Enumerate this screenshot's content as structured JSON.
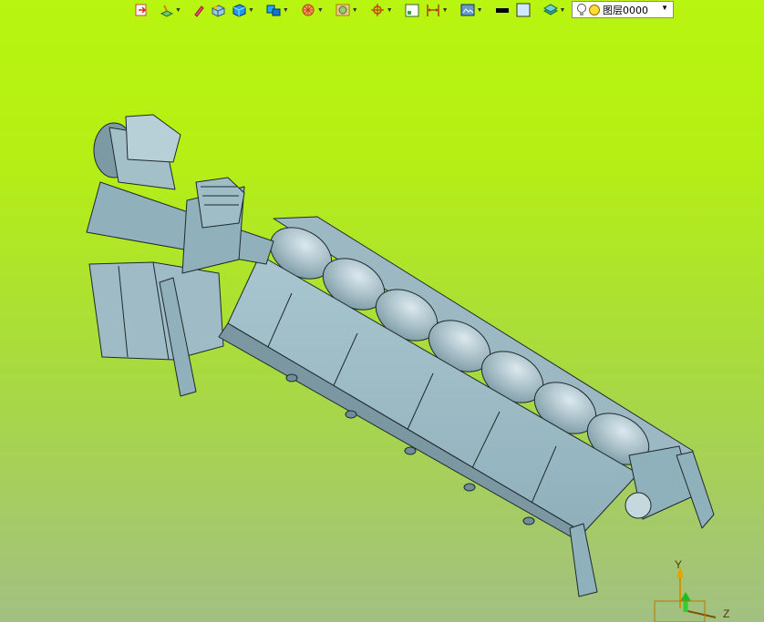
{
  "toolbar": {
    "buttons": [
      {
        "name": "exit-sketch-icon",
        "has_menu": false
      },
      {
        "name": "sketch-plane-icon",
        "has_menu": true
      },
      {
        "name": "pencil-edit-icon",
        "has_menu": false
      },
      {
        "name": "part-box-icon",
        "has_menu": false
      },
      {
        "name": "solid-cube-icon",
        "has_menu": true
      },
      {
        "name": "assembly-blocks-icon",
        "has_menu": true
      },
      {
        "name": "section-sphere-icon",
        "has_menu": true
      },
      {
        "name": "frame-select-icon",
        "has_menu": true
      },
      {
        "name": "snap-crosshair-icon",
        "has_menu": true
      },
      {
        "name": "grid-icon",
        "has_menu": false
      },
      {
        "name": "dimension-icon",
        "has_menu": true
      },
      {
        "name": "view-display-icon",
        "has_menu": true
      },
      {
        "name": "line-color-swatch",
        "has_menu": false
      },
      {
        "name": "fill-color-swatch",
        "has_menu": false
      },
      {
        "name": "layers-stack-icon",
        "has_menu": true
      }
    ],
    "colors": {
      "line": "#000000",
      "fill": "#cfe8fb"
    }
  },
  "layer": {
    "value": "图层0000"
  },
  "triad": {
    "y_label": "Y",
    "z_label": "Z"
  }
}
